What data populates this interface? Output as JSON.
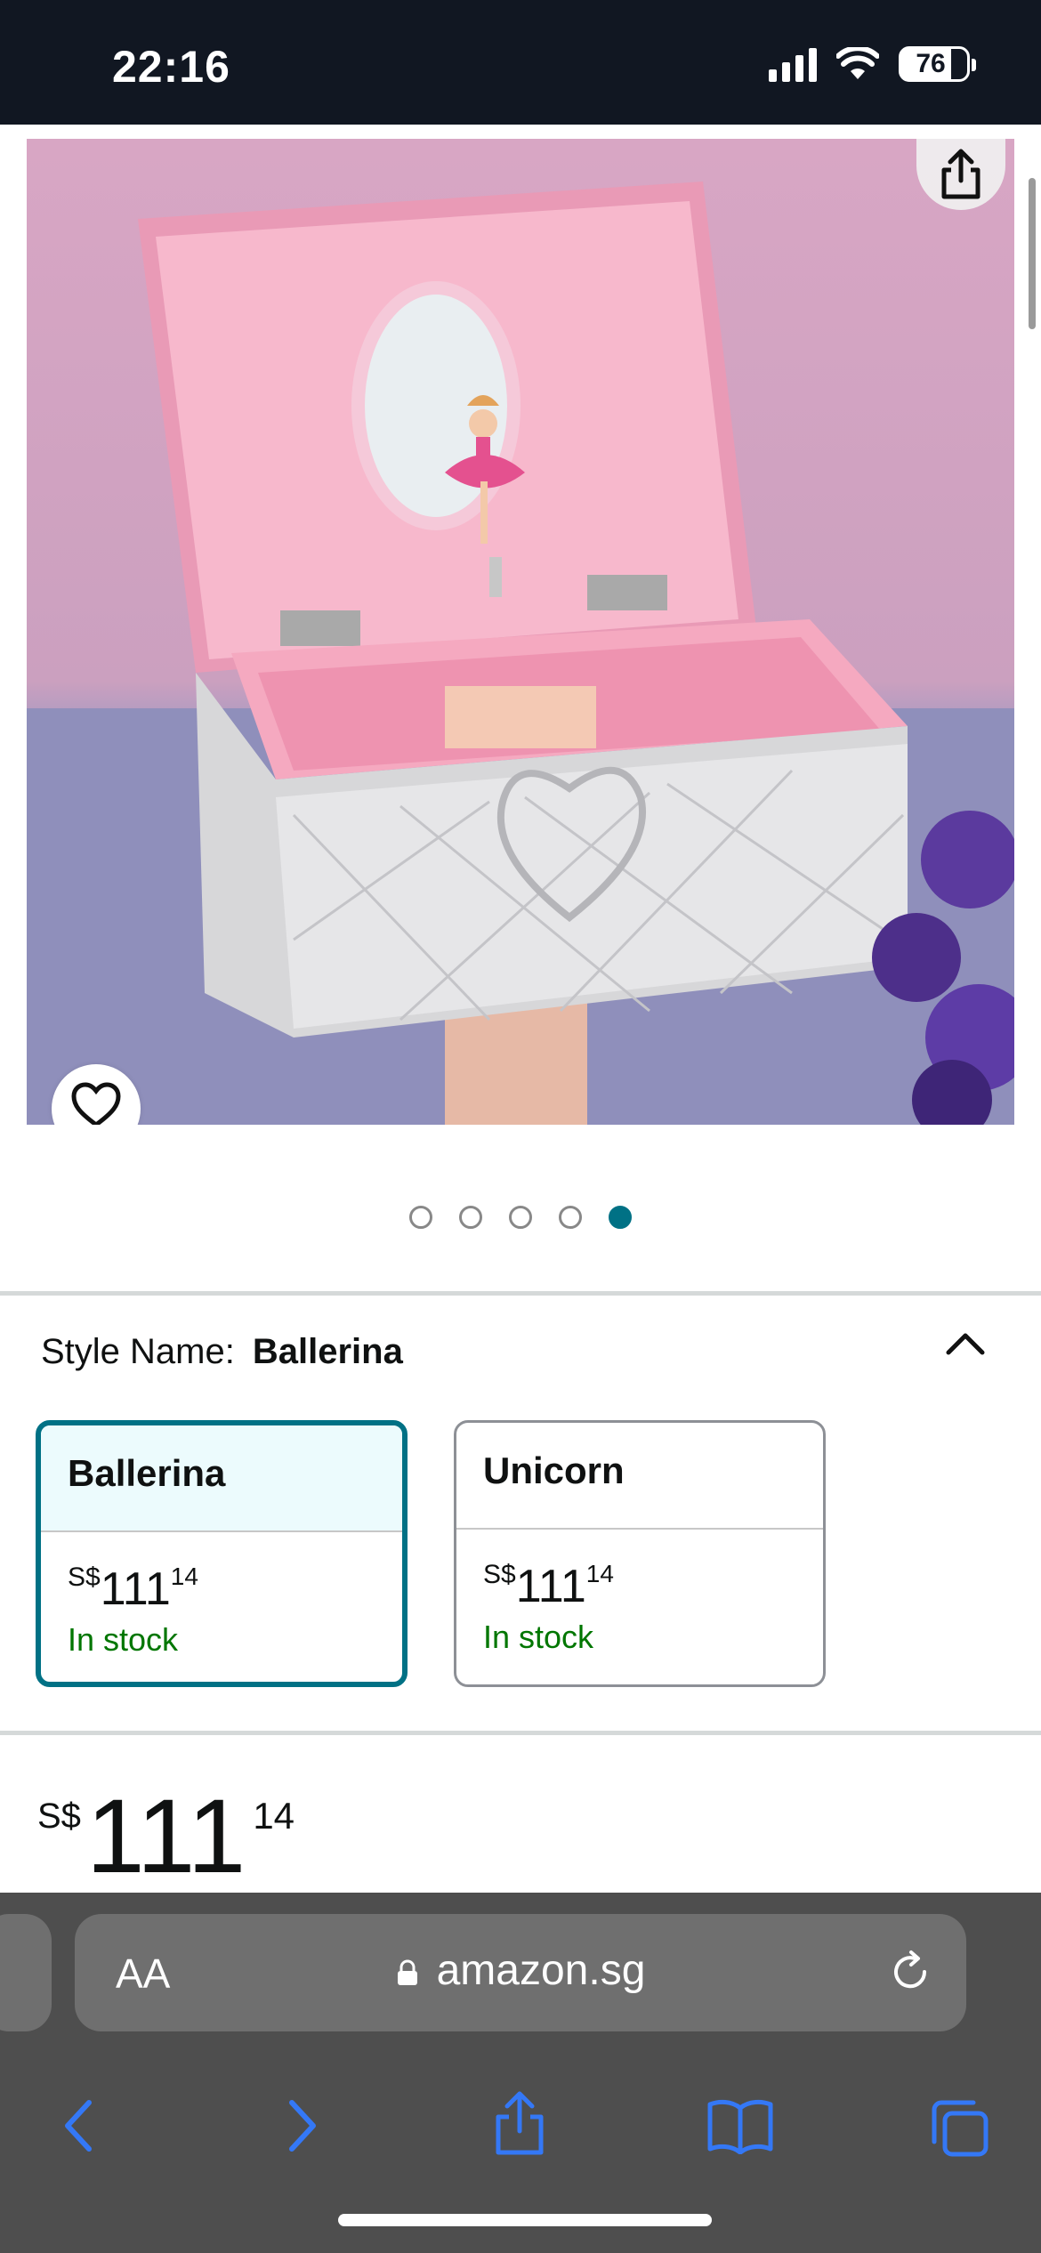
{
  "status_bar": {
    "time": "22:16",
    "battery": "76",
    "icons": [
      "signal-icon",
      "wifi-icon",
      "battery-icon"
    ]
  },
  "product": {
    "image_name": "ballerina-music-jewelry-box",
    "gallery_page": 5,
    "gallery_total": 5
  },
  "variation": {
    "label": "Style Name:",
    "selected": "Ballerina",
    "options": [
      {
        "name": "Ballerina",
        "currency": "S$",
        "whole": "111",
        "fraction": "14",
        "stock": "In stock"
      },
      {
        "name": "Unicorn",
        "currency": "S$",
        "whole": "111",
        "fraction": "14",
        "stock": "In stock"
      }
    ]
  },
  "price": {
    "currency": "S$",
    "whole": "111",
    "fraction": "14"
  },
  "browser": {
    "text_size": "AA",
    "url": "amazon.sg"
  },
  "colors": {
    "accent": "#007185",
    "stock": "#007600",
    "status_bg": "#111722",
    "browser_bg": "#4e4e4e",
    "link_blue": "#3478f6"
  }
}
